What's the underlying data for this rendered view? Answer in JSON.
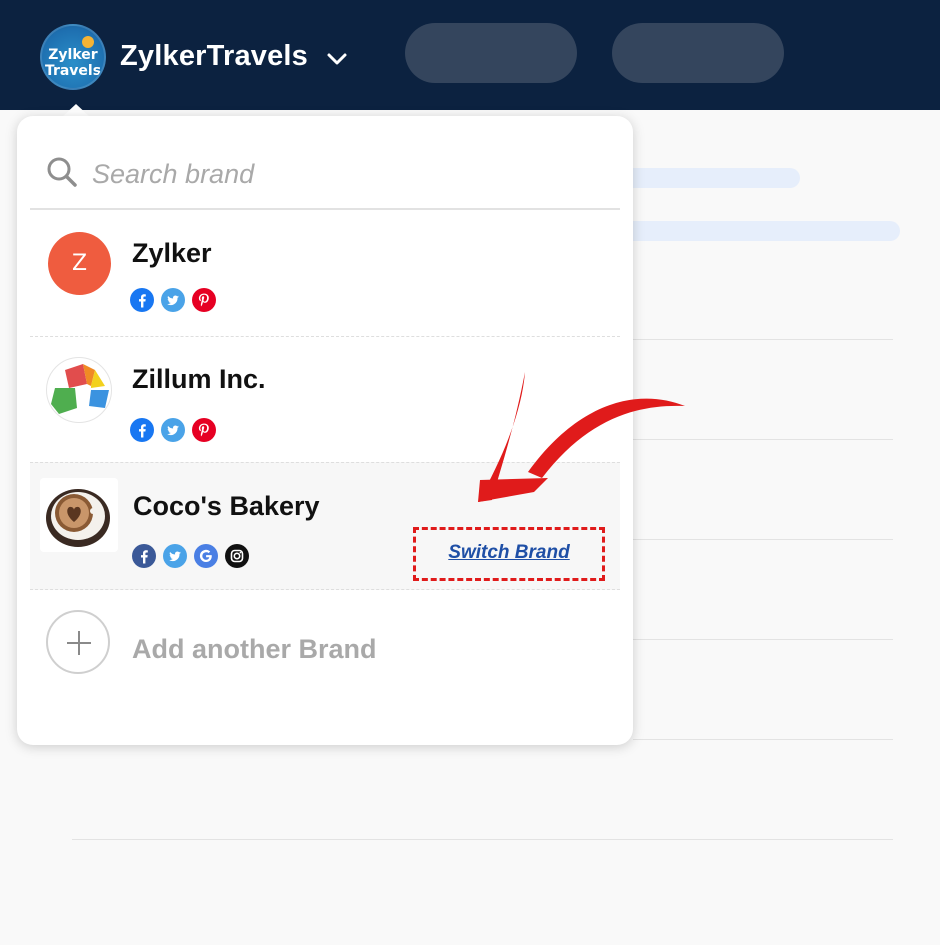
{
  "header": {
    "logo_text_line1": "Zylker",
    "logo_text_line2": "Travels",
    "brand_name": "ZylkerTravels",
    "brand_dropdown_icon": "chevron-down-icon"
  },
  "brand_switcher": {
    "search": {
      "placeholder": "Search brand",
      "value": ""
    },
    "brands": [
      {
        "name": "Zylker",
        "avatar_letter": "Z",
        "avatar_color": "#ef5c3f",
        "networks": [
          "facebook-icon",
          "twitter-icon",
          "pinterest-icon"
        ]
      },
      {
        "name": "Zillum Inc.",
        "networks": [
          "facebook-icon",
          "twitter-icon",
          "pinterest-icon"
        ]
      },
      {
        "name": "Coco's Bakery",
        "networks": [
          "facebook-icon",
          "twitter-icon",
          "google-icon",
          "instagram-icon"
        ],
        "action_label": "Switch Brand"
      }
    ],
    "add_label": "Add another Brand"
  },
  "colors": {
    "topbar": "#0c2240",
    "highlight": "#e01b1b",
    "link": "#1f4fa6"
  }
}
